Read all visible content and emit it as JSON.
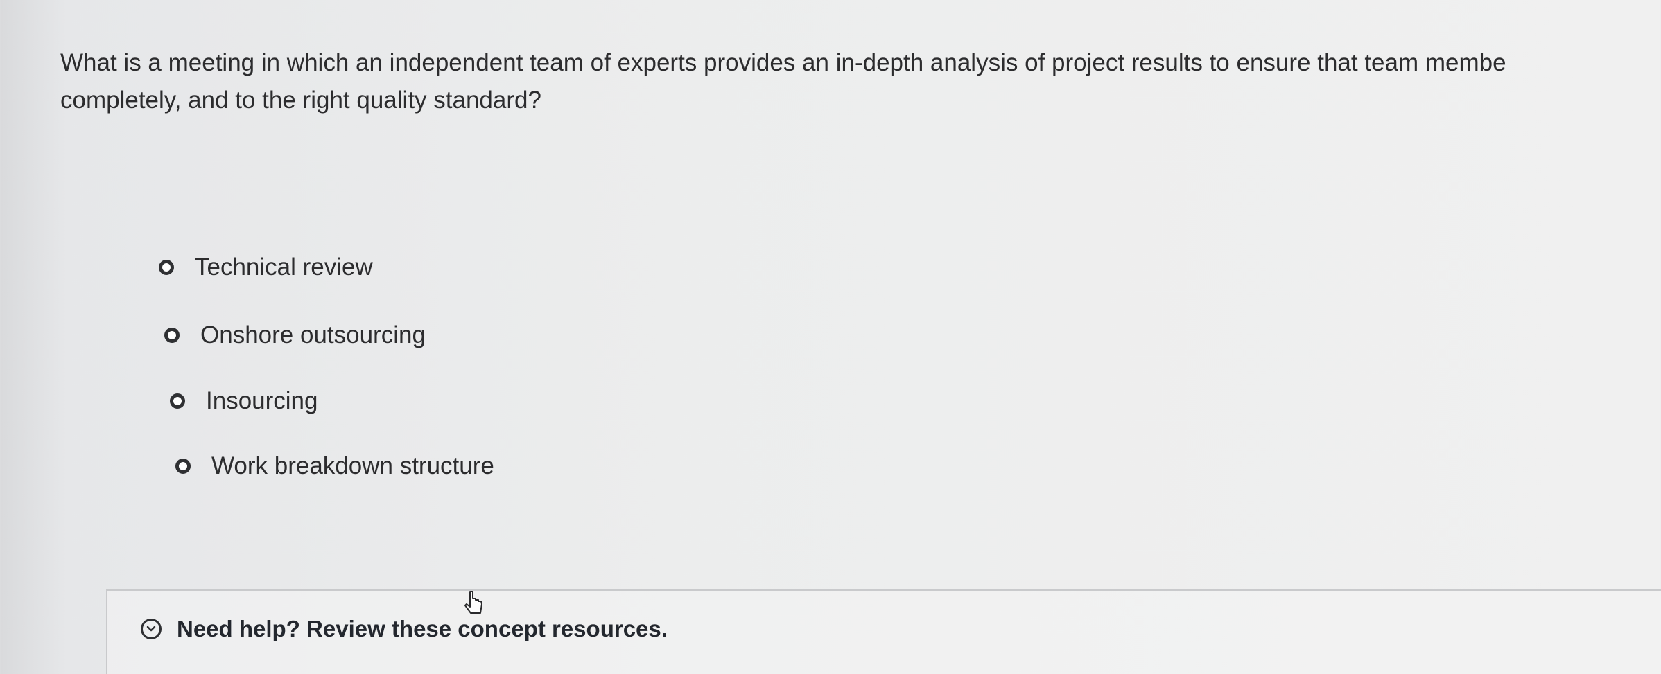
{
  "question": {
    "text": "What is a meeting in which an independent team of experts provides an in-depth analysis of project results to ensure that team membe\ncompletely, and to the right quality standard?"
  },
  "options": [
    {
      "label": "Technical review",
      "selected": false
    },
    {
      "label": "Onshore outsourcing",
      "selected": false
    },
    {
      "label": "Insourcing",
      "selected": false
    },
    {
      "label": "Work breakdown structure",
      "selected": false
    }
  ],
  "help": {
    "label": "Need help? Review these concept resources.",
    "icon": "chevron-down-circle-icon"
  },
  "cursor": {
    "icon": "pointer-cursor-icon"
  }
}
